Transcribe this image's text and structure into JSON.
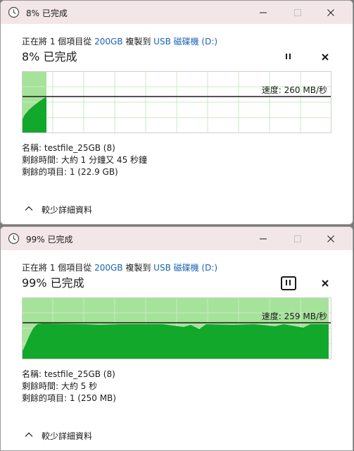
{
  "dialogs": [
    {
      "title": "8% 已完成",
      "source_prefix": "正在將 1 個項目從 ",
      "source_name": "200GB",
      "dest_mid": " 複製到 ",
      "dest_name": "USB 磁碟機 (D:)",
      "progress_text": "8% 已完成",
      "progress_fraction": 0.08,
      "speed_label": "速度: 260 MB/秒",
      "details": {
        "name": "名稱: testfile_25GB (8)",
        "time_remaining": "剩餘時間: 大約 1 分鐘又 45 秒鐘",
        "items_remaining": "剩餘的項目: 1 (22.9 GB)"
      },
      "less_details": "較少詳細資料",
      "pause_focused": false
    },
    {
      "title": "99% 已完成",
      "source_prefix": "正在將 1 個項目從 ",
      "source_name": "200GB",
      "dest_mid": " 複製到 ",
      "dest_name": "USB 磁碟機 (D:)",
      "progress_text": "99% 已完成",
      "progress_fraction": 0.99,
      "speed_label": "速度: 259 MB/秒",
      "details": {
        "name": "名稱: testfile_25GB (8)",
        "time_remaining": "剩餘時間: 大約 5 秒",
        "items_remaining": "剩餘的項目: 1 (250 MB)"
      },
      "less_details": "較少詳細資料",
      "pause_focused": true
    }
  ],
  "colors": {
    "titlebar_bg": "#f3e6e9",
    "link": "#1a62b3",
    "graph_progress_bg": "#a6e39a",
    "graph_speed_fill": "#11a82b",
    "graph_grid": "#c9e9c4",
    "graph_border": "#cfcfcf",
    "speed_line": "#1b1b1b"
  },
  "icons": {
    "app": "clock-icon",
    "minimize": "minimize-icon",
    "maximize": "maximize-icon",
    "close": "close-icon",
    "pause": "pause-icon",
    "stop": "stop-icon",
    "collapse": "chevron-up-icon"
  }
}
